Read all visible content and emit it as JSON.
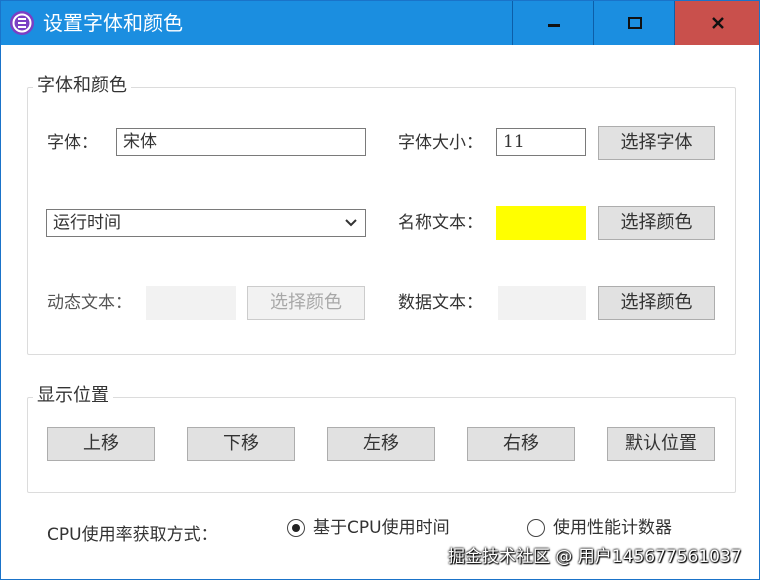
{
  "window": {
    "title": "设置字体和颜色",
    "icon": "app-logo-icon",
    "controls": {
      "minimize": "minimize-icon",
      "maximize": "maximize-icon",
      "close": "close-icon"
    },
    "colors": {
      "titlebar": "#1b8ee0",
      "close_bg": "#c9504c"
    }
  },
  "font_group": {
    "title": "字体和颜色",
    "font_label": "字体：",
    "font_value": "宋体",
    "size_label": "字体大小：",
    "size_value": "11",
    "choose_font_button": "选择字体",
    "item_select": {
      "selected": "运行时间"
    },
    "name_text_label": "名称文本：",
    "name_text_color": "#ffff00",
    "name_choose_color_button": "选择颜色",
    "dynamic_text_label": "动态文本：",
    "dynamic_text_color": "#f2f2f2",
    "dynamic_choose_color_button": "选择颜色",
    "data_text_label": "数据文本：",
    "data_text_color": "#f2f2f2",
    "data_choose_color_button": "选择颜色"
  },
  "position_group": {
    "title": "显示位置",
    "buttons": {
      "up": "上移",
      "down": "下移",
      "left": "左移",
      "right": "右移",
      "default": "默认位置"
    }
  },
  "cpu": {
    "label": "CPU使用率获取方式：",
    "options": [
      {
        "label": "基于CPU使用时间",
        "selected": true
      },
      {
        "label": "使用性能计数器",
        "selected": false
      }
    ]
  },
  "watermark": "掘金技术社区 @ 用户145677561037"
}
